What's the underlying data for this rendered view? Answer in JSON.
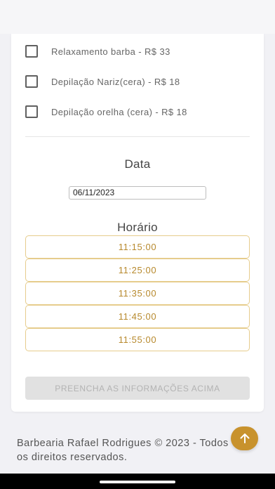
{
  "services": [
    {
      "label": "Relaxamento barba - R$ 33",
      "checked": false
    },
    {
      "label": "Depilação Nariz(cera) - R$ 18",
      "checked": false
    },
    {
      "label": "Depilação orelha (cera) - R$ 18",
      "checked": false
    }
  ],
  "date_section": {
    "title": "Data",
    "value": "06/11/2023"
  },
  "time_section": {
    "title": "Horário",
    "slots": [
      "11:15:00",
      "11:25:00",
      "11:35:00",
      "11:45:00",
      "11:55:00"
    ]
  },
  "submit_label": "PREENCHA AS INFORMAÇÕES ACIMA",
  "footer": {
    "line1": "Barbearia Rafael Rodrigues © 2023 - Todos",
    "line2": "os direitos reservados."
  },
  "fab_icon": "arrow-up-icon",
  "colors": {
    "accent": "#c8922d",
    "slot_border": "#e6cc8c",
    "slot_text": "#b7892d",
    "disabled_bg": "#e1e1e1"
  }
}
